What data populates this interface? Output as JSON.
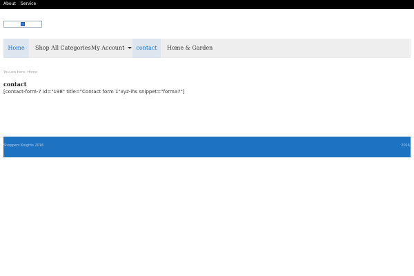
{
  "topbar": {
    "links": [
      "About",
      "Service"
    ]
  },
  "logo": {
    "icon": "image-icon"
  },
  "nav": {
    "items": [
      {
        "label": "Home",
        "active": true
      },
      {
        "label": "Shop All Categories",
        "active": false
      },
      {
        "label": "My Account",
        "active": false,
        "has_dropdown": true
      },
      {
        "label": "contact",
        "active": true
      },
      {
        "label": "Home & Garden",
        "active": false
      }
    ]
  },
  "breadcrumb": {
    "text": "You are here: Home"
  },
  "main": {
    "title": "contact",
    "content": "[contact-form-7 id=\"198\" title=\"Contact form 1\"xyz-ihs snippet=\"forma7\"]"
  },
  "footer": {
    "left": "Shoppers Knights 2016",
    "right": "2016"
  },
  "colors": {
    "topbar_bg": "#000000",
    "nav_bg": "#eeeeee",
    "nav_active_text": "#1a73c7",
    "footer_bg": "#1e72c2"
  }
}
